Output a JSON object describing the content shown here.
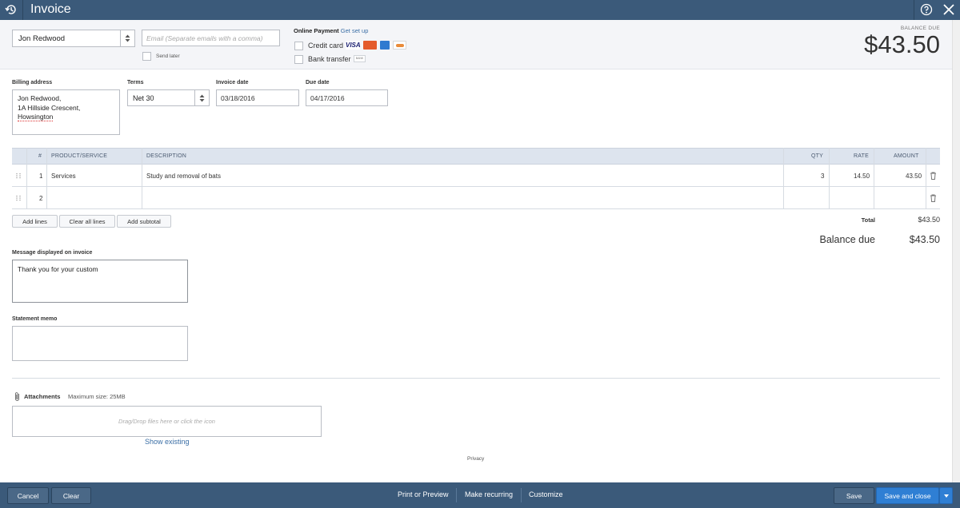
{
  "window": {
    "title": "Invoice"
  },
  "customer": {
    "name": "Jon Redwood"
  },
  "email": {
    "placeholder": "Email (Separate emails with a comma)"
  },
  "send_later": {
    "label": "Send later"
  },
  "online_payment": {
    "title": "Online Payment",
    "link": "Get set up",
    "credit_card_label": "Credit card",
    "bank_transfer_label": "Bank transfer",
    "visa_text": "VISA",
    "bank_badge_text": "BANK"
  },
  "balance": {
    "label": "BALANCE DUE",
    "amount": "$43.50"
  },
  "billing": {
    "label": "Billing address",
    "line1": "Jon Redwood,",
    "line2": "1A Hillside Crescent,",
    "line3": "Howsington"
  },
  "terms": {
    "label": "Terms",
    "value": "Net 30"
  },
  "invoice_date": {
    "label": "Invoice date",
    "value": "03/18/2016"
  },
  "due_date": {
    "label": "Due date",
    "value": "04/17/2016"
  },
  "table": {
    "headers": {
      "num": "#",
      "product": "PRODUCT/SERVICE",
      "description": "DESCRIPTION",
      "qty": "QTY",
      "rate": "RATE",
      "amount": "AMOUNT"
    },
    "rows": [
      {
        "num": "1",
        "product": "Services",
        "description": "Study and removal of bats",
        "qty": "3",
        "rate": "14.50",
        "amount": "43.50"
      },
      {
        "num": "2",
        "product": "",
        "description": "",
        "qty": "",
        "rate": "",
        "amount": ""
      }
    ]
  },
  "line_actions": {
    "add_lines": "Add lines",
    "clear_all": "Clear all lines",
    "add_subtotal": "Add subtotal"
  },
  "totals": {
    "total_label": "Total",
    "total_amount": "$43.50",
    "balance_due_label": "Balance due",
    "balance_due_amount": "$43.50"
  },
  "message": {
    "label": "Message displayed on invoice",
    "value": "Thank you for your custom"
  },
  "memo": {
    "label": "Statement memo"
  },
  "attachments": {
    "label": "Attachments",
    "max_size": "Maximum size: 25MB",
    "drop_text": "Drag/Drop files here or click the icon",
    "show_existing": "Show existing"
  },
  "privacy": "Privacy",
  "footer": {
    "cancel": "Cancel",
    "clear": "Clear",
    "print_preview": "Print or Preview",
    "make_recurring": "Make recurring",
    "customize": "Customize",
    "save": "Save",
    "save_close": "Save and close"
  },
  "colors": {
    "header_bar": "#3b5a7a",
    "primary_button": "#2f7fd4",
    "link": "#3a6ea5",
    "table_header": "#dde4ee"
  }
}
